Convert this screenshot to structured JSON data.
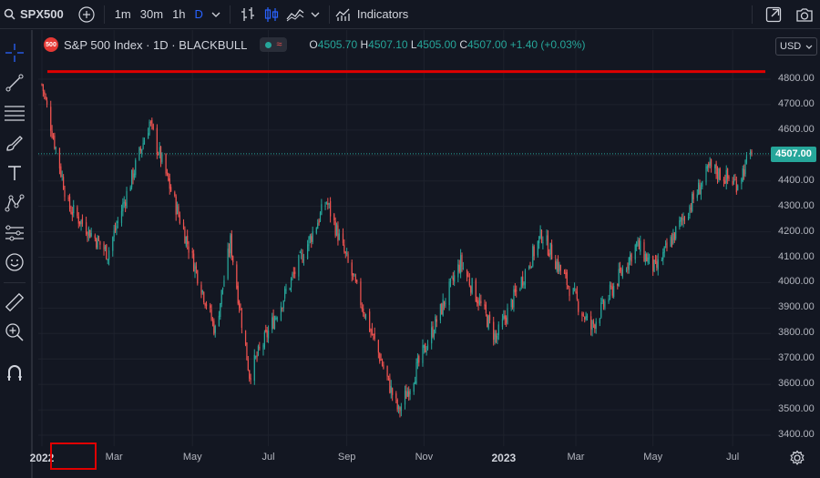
{
  "topbar": {
    "symbol": "SPX500",
    "intervals": [
      "1m",
      "30m",
      "1h",
      "D"
    ],
    "active_interval": "D",
    "indicators_label": "Indicators",
    "icons": [
      "search-icon",
      "add-symbol-icon",
      "chevron-down-icon",
      "bar-type-icon",
      "candles-icon",
      "area-chart-icon",
      "chevron-down-icon",
      "indicators-icon",
      "fullscreen-icon",
      "snapshot-icon"
    ]
  },
  "legend": {
    "badge": "500",
    "title": "S&P 500 Index · 1D · BLACKBULL",
    "ohlc": {
      "o_label": "O",
      "o": "4505.70",
      "h_label": "H",
      "h": "4507.10",
      "l_label": "L",
      "l": "4505.00",
      "c_label": "C",
      "c": "4507.00",
      "change": "+1.40 (+0.03%)"
    }
  },
  "currency": "USD",
  "price_axis": {
    "ticks": [
      "4800.00",
      "4700.00",
      "4600.00",
      "4500.00",
      "4400.00",
      "4300.00",
      "4200.00",
      "4100.00",
      "4000.00",
      "3900.00",
      "3800.00",
      "3700.00",
      "3600.00",
      "3500.00",
      "3400.00"
    ],
    "last_price": "4507.00"
  },
  "time_axis": {
    "labels": [
      "2022",
      "Mar",
      "May",
      "Jul",
      "Sep",
      "Nov",
      "2023",
      "Mar",
      "May",
      "Jul"
    ]
  },
  "sidebar": {
    "tools": [
      "crosshair-icon",
      "trend-line-icon",
      "fib-icon",
      "brush-icon",
      "text-icon",
      "pattern-icon",
      "forecast-icon",
      "emoji-icon",
      "ruler-icon",
      "zoom-icon",
      "magnet-icon"
    ]
  },
  "annotations": {
    "resistance_line_price": 4830,
    "year_highlight": "2022"
  },
  "colors": {
    "background": "#131722",
    "up": "#26a69a",
    "down": "#ef5350",
    "annotation": "#e00000",
    "accent": "#2962ff"
  },
  "chart_data": {
    "type": "candlestick",
    "symbol": "SPX500",
    "interval": "1D",
    "ylim": [
      3400,
      4850
    ],
    "x_start": "2022-01-03",
    "x_end": "2023-07-18",
    "key_points": [
      {
        "x": "2022-01-03",
        "y": 4780
      },
      {
        "x": "2022-01-24",
        "y": 4300
      },
      {
        "x": "2022-02-24",
        "y": 4115
      },
      {
        "x": "2022-03-29",
        "y": 4630
      },
      {
        "x": "2022-05-20",
        "y": 3810
      },
      {
        "x": "2022-06-01",
        "y": 4160
      },
      {
        "x": "2022-06-16",
        "y": 3640
      },
      {
        "x": "2022-08-16",
        "y": 4320
      },
      {
        "x": "2022-10-12",
        "y": 3490
      },
      {
        "x": "2022-11-30",
        "y": 4080
      },
      {
        "x": "2022-12-28",
        "y": 3780
      },
      {
        "x": "2023-02-02",
        "y": 4190
      },
      {
        "x": "2023-03-13",
        "y": 3820
      },
      {
        "x": "2023-04-18",
        "y": 4150
      },
      {
        "x": "2023-05-03",
        "y": 4050
      },
      {
        "x": "2023-06-15",
        "y": 4450
      },
      {
        "x": "2023-07-06",
        "y": 4390
      },
      {
        "x": "2023-07-18",
        "y": 4507
      }
    ]
  }
}
